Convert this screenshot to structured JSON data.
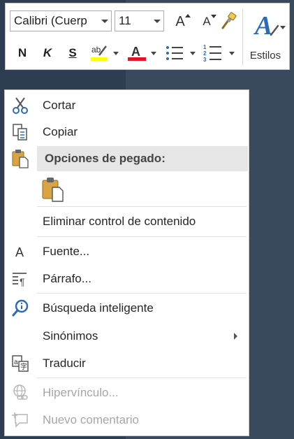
{
  "toolbar": {
    "font_name": "Calibri (Cuerp",
    "font_size": "11",
    "grow_font_glyph": "A",
    "shrink_font_glyph": "A",
    "bold": "N",
    "italic": "K",
    "underline": "S",
    "highlight_glyph": "ab",
    "font_color_glyph": "A",
    "styles_glyph": "A",
    "styles_label": "Estilos",
    "colors": {
      "highlight": "#ffff00",
      "font_color": "#e81123",
      "accent": "#2b6cb8"
    }
  },
  "menu": {
    "items": [
      {
        "id": "cut",
        "label": "Cortar",
        "icon": "scissors-icon",
        "enabled": true
      },
      {
        "id": "copy",
        "label": "Copiar",
        "icon": "copy-icon",
        "enabled": true
      },
      {
        "id": "paste_header",
        "label": "Opciones de pegado:",
        "icon": "paste-icon"
      },
      {
        "id": "paste_keep",
        "icon": "paste-keep-source-icon",
        "enabled": true
      },
      {
        "id": "remove_content_control",
        "label": "Eliminar control de contenido",
        "enabled": true
      },
      {
        "id": "font",
        "label": "Fuente...",
        "icon": "font-icon",
        "enabled": true
      },
      {
        "id": "paragraph",
        "label": "Párrafo...",
        "icon": "paragraph-icon",
        "enabled": true
      },
      {
        "id": "smart_lookup",
        "label": "Búsqueda inteligente",
        "icon": "smart-lookup-icon",
        "enabled": true
      },
      {
        "id": "synonyms",
        "label": "Sinónimos",
        "has_submenu": true,
        "enabled": true
      },
      {
        "id": "translate",
        "label": "Traducir",
        "icon": "translate-icon",
        "enabled": true
      },
      {
        "id": "hyperlink",
        "label": "Hipervínculo...",
        "icon": "hyperlink-icon",
        "enabled": false
      },
      {
        "id": "new_comment",
        "label": "Nuevo comentario",
        "icon": "new-comment-icon",
        "enabled": false
      }
    ]
  }
}
